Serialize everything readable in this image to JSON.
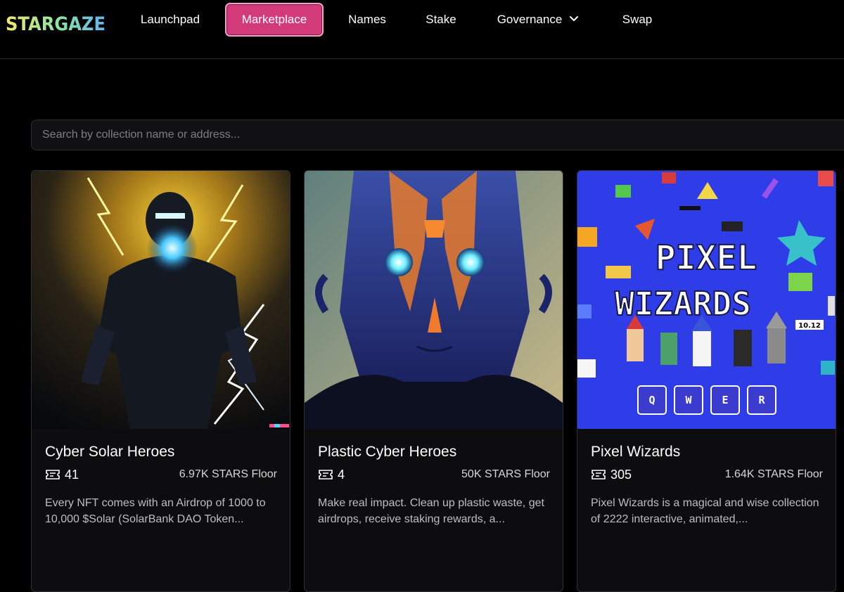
{
  "brand": {
    "logo_text": "STARGAZE"
  },
  "nav": {
    "items": [
      {
        "label": "Launchpad"
      },
      {
        "label": "Marketplace",
        "active": true
      },
      {
        "label": "Names"
      },
      {
        "label": "Stake"
      },
      {
        "label": "Governance",
        "has_dropdown": true
      },
      {
        "label": "Swap"
      }
    ]
  },
  "search": {
    "placeholder": "Search by collection name or address...",
    "value": ""
  },
  "collections": [
    {
      "title": "Cyber Solar Heroes",
      "count": "41",
      "floor": "6.97K STARS Floor",
      "description": "Every NFT comes with an Airdrop of 1000 to 10,000 $Solar (SolarBank DAO Token..."
    },
    {
      "title": "Plastic Cyber Heroes",
      "count": "4",
      "floor": "50K STARS Floor",
      "description": "Make real impact. Clean up plastic waste, get airdrops, receive staking rewards, a..."
    },
    {
      "title": "Pixel Wizards",
      "count": "305",
      "floor": "1.64K STARS Floor",
      "description": "Pixel Wizards is a magical and wise collection of 2222 interactive, animated,...",
      "art": {
        "line1": "PIXEL",
        "line2": "WIZARDS",
        "badge": "10.12",
        "keys": [
          "Q",
          "W",
          "E",
          "R"
        ]
      }
    }
  ],
  "colors": {
    "active_nav": "#d23a7a",
    "background": "#000000",
    "card_bg": "#0d0d0f",
    "pixel_wizards_bg": "#2f3de8"
  },
  "icons": [
    "ticket-icon",
    "chevron-down-icon"
  ]
}
